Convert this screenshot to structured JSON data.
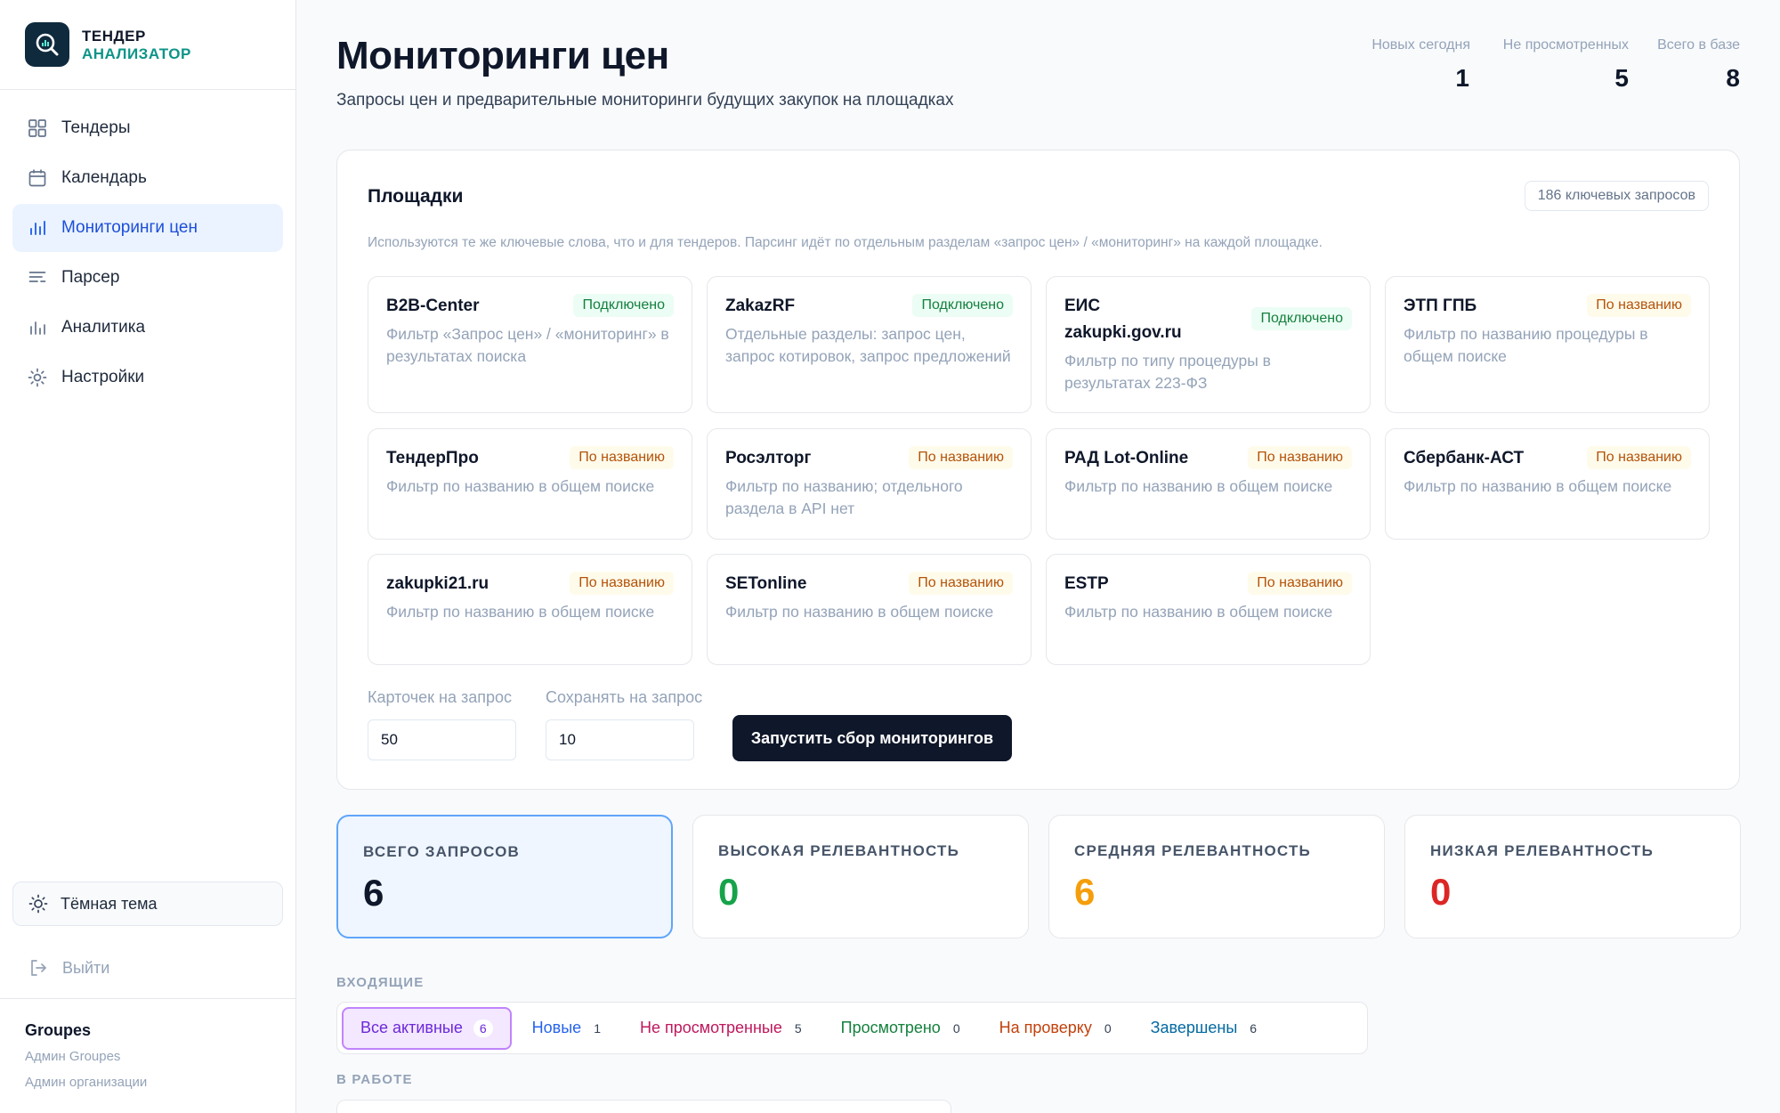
{
  "brand": {
    "line1": "ТЕНДЕР",
    "line2": "АНАЛИЗАТОР"
  },
  "nav": [
    {
      "label": "Тендеры",
      "icon": "grid-icon",
      "active": false
    },
    {
      "label": "Календарь",
      "icon": "calendar-icon",
      "active": false
    },
    {
      "label": "Мониторинги цен",
      "icon": "bar-chart-icon",
      "active": true
    },
    {
      "label": "Парсер",
      "icon": "filter-lines-icon",
      "active": false
    },
    {
      "label": "Аналитика",
      "icon": "analytics-icon",
      "active": false
    },
    {
      "label": "Настройки",
      "icon": "gear-icon",
      "active": false
    }
  ],
  "theme_toggle": {
    "label": "Тёмная тема",
    "icon": "sun-icon"
  },
  "logout": {
    "label": "Выйти",
    "icon": "logout-icon"
  },
  "org": {
    "name": "Groupes",
    "role1": "Админ Groupes",
    "role2": "Админ организации"
  },
  "header": {
    "title": "Мониторинги цен",
    "subtitle": "Запросы цен и предварительные мониторинги будущих закупок на площадках"
  },
  "stats": [
    {
      "label": "Новых сегодня",
      "value": "1"
    },
    {
      "label": "Не просмотренных",
      "value": "5"
    },
    {
      "label": "Всего в базе",
      "value": "8"
    }
  ],
  "platforms_card": {
    "title": "Площадки",
    "badge": "186 ключевых запросов",
    "description": "Используются те же ключевые слова, что и для тендеров. Парсинг идёт по отдельным разделам «запрос цен» / «мониторинг» на каждой площадке.",
    "platforms": [
      {
        "name": "B2B-Center",
        "status": "Подключено",
        "kind": "ok",
        "desc": "Фильтр «Запрос цен» / «мониторинг» в результатах поиска"
      },
      {
        "name": "ZakazRF",
        "status": "Подключено",
        "kind": "ok",
        "desc": "Отдельные разделы: запрос цен, запрос котировок, запрос предложений"
      },
      {
        "name": "ЕИС zakupki.gov.ru",
        "status": "Подключено",
        "kind": "ok",
        "desc": "Фильтр по типу процедуры в результатах 223-ФЗ"
      },
      {
        "name": "ЭТП ГПБ",
        "status": "По названию",
        "kind": "name",
        "desc": "Фильтр по названию процедуры в общем поиске"
      },
      {
        "name": "ТендерПро",
        "status": "По названию",
        "kind": "name",
        "desc": "Фильтр по названию в общем поиске"
      },
      {
        "name": "Росэлторг",
        "status": "По названию",
        "kind": "name",
        "desc": "Фильтр по названию; отдельного раздела в API нет"
      },
      {
        "name": "РАД Lot-Online",
        "status": "По названию",
        "kind": "name",
        "desc": "Фильтр по названию в общем поиске"
      },
      {
        "name": "Сбербанк-АСТ",
        "status": "По названию",
        "kind": "name",
        "desc": "Фильтр по названию в общем поиске"
      },
      {
        "name": "zakupki21.ru",
        "status": "По названию",
        "kind": "name",
        "desc": "Фильтр по названию в общем поиске"
      },
      {
        "name": "SETonline",
        "status": "По названию",
        "kind": "name",
        "desc": "Фильтр по названию в общем поиске"
      },
      {
        "name": "ESTP",
        "status": "По названию",
        "kind": "name",
        "desc": "Фильтр по названию в общем поиске"
      }
    ],
    "cards_label": "Карточек на запрос",
    "cards_value": "50",
    "save_label": "Сохранять на запрос",
    "save_value": "10",
    "run_button": "Запустить сбор мониторингов"
  },
  "summary": [
    {
      "label": "ВСЕГО ЗАПРОСОВ",
      "value": "6",
      "color": "#0f172a",
      "active": true
    },
    {
      "label": "ВЫСОКАЯ РЕЛЕВАНТНОСТЬ",
      "value": "0",
      "color": "#16a34a",
      "active": false
    },
    {
      "label": "СРЕДНЯЯ РЕЛЕВАНТНОСТЬ",
      "value": "6",
      "color": "#f59e0b",
      "active": false
    },
    {
      "label": "НИЗКАЯ РЕЛЕВАНТНОСТЬ",
      "value": "0",
      "color": "#dc2626",
      "active": false
    }
  ],
  "incoming_label": "ВХОДЯЩИЕ",
  "tabs": [
    {
      "label": "Все активные",
      "count": "6",
      "color": "#6d28d9",
      "active": true
    },
    {
      "label": "Новые",
      "count": "1",
      "color": "#2563eb",
      "active": false
    },
    {
      "label": "Не просмотренные",
      "count": "5",
      "color": "#be185d",
      "active": false
    },
    {
      "label": "Просмотрено",
      "count": "0",
      "color": "#15803d",
      "active": false
    },
    {
      "label": "На проверку",
      "count": "0",
      "color": "#c2410c",
      "active": false
    },
    {
      "label": "Завершены",
      "count": "6",
      "color": "#0369a1",
      "active": false
    }
  ],
  "in_work_label": "В РАБОТЕ"
}
